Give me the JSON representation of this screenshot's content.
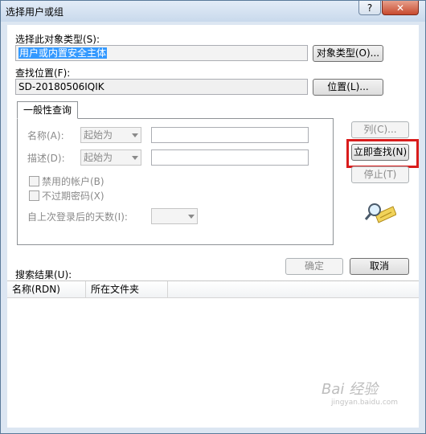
{
  "window": {
    "title": "选择用户或组",
    "help_label": "?",
    "close_label": "✕"
  },
  "object_type": {
    "label": "选择此对象类型(S):",
    "value": "用户或内置安全主体",
    "button": "对象类型(O)..."
  },
  "location": {
    "label": "查找位置(F):",
    "value": "SD-20180506IQIK",
    "button": "位置(L)..."
  },
  "tab": {
    "label": "一般性查询"
  },
  "query": {
    "name_label": "名称(A):",
    "name_mode": "起始为",
    "desc_label": "描述(D):",
    "desc_mode": "起始为",
    "disabled_accounts": "禁用的帐户(B)",
    "non_expiring_pw": "不过期密码(X)",
    "days_label": "自上次登录后的天数(I):"
  },
  "side_buttons": {
    "columns": "列(C)...",
    "find_now": "立即查找(N)",
    "stop": "停止(T)"
  },
  "dialog_buttons": {
    "ok": "确定",
    "cancel": "取消"
  },
  "results": {
    "label": "搜索结果(U):",
    "columns": [
      "名称(RDN)",
      "所在文件夹"
    ]
  },
  "watermark": {
    "text": "Bai 经验",
    "sub": "jingyan.baidu.com"
  },
  "colors": {
    "highlight": "#d91c1c",
    "selection": "#3399ff"
  }
}
